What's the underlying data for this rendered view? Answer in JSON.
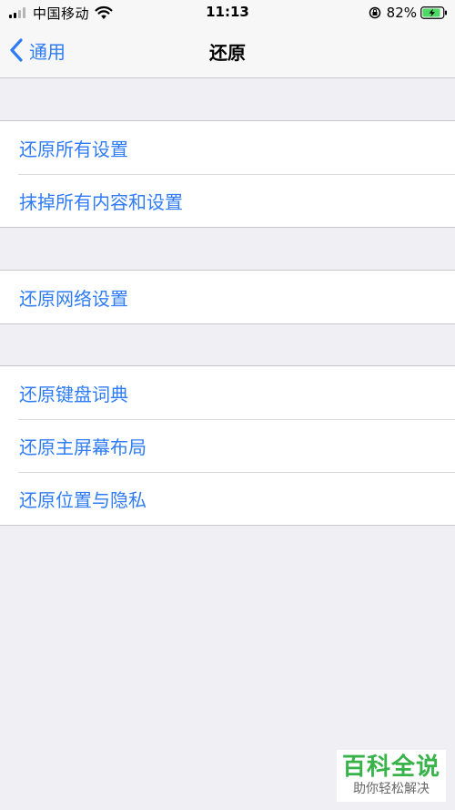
{
  "status_bar": {
    "carrier": "中国移动",
    "time": "11:13",
    "battery_percent": "82%",
    "icons": [
      "signal-icon",
      "wifi-icon",
      "rotation-lock-icon",
      "battery-charging-icon"
    ]
  },
  "nav": {
    "back_label": "通用",
    "title": "还原",
    "back_icon": "chevron-left-icon"
  },
  "groups": [
    {
      "items": [
        {
          "label": "还原所有设置"
        },
        {
          "label": "抹掉所有内容和设置"
        }
      ]
    },
    {
      "items": [
        {
          "label": "还原网络设置"
        }
      ]
    },
    {
      "items": [
        {
          "label": "还原键盘词典"
        },
        {
          "label": "还原主屏幕布局"
        },
        {
          "label": "还原位置与隐私"
        }
      ]
    }
  ],
  "watermark": {
    "title": "百科全说",
    "subtitle": "助你轻松解决"
  },
  "colors": {
    "accent": "#2f7cf6",
    "background": "#efeff4",
    "watermark_green": "#37b34a"
  }
}
